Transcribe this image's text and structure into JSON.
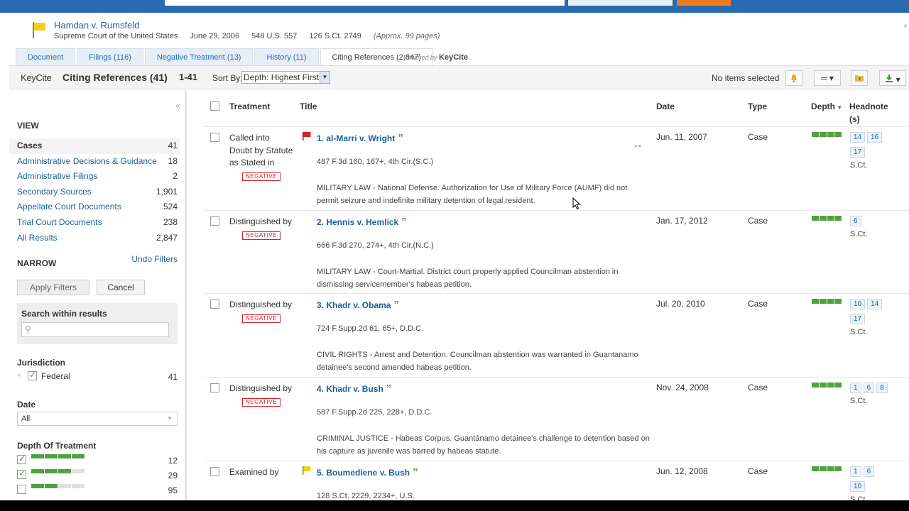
{
  "doc": {
    "title": "Hamdan v. Rumsfeld",
    "court": "Supreme Court of the United States",
    "date": "June 29, 2006",
    "cite1": "548 U.S. 557",
    "cite2": "126 S.Ct. 2749",
    "pages": "(Approx. 99 pages)"
  },
  "tabs": [
    {
      "label": "Document"
    },
    {
      "label": "Filings (116)"
    },
    {
      "label": "Negative Treatment (13)"
    },
    {
      "label": "History (11)"
    },
    {
      "label": "Citing References (2,847)"
    }
  ],
  "powered": {
    "prefix": "Powered by",
    "brand": "KeyCite"
  },
  "toolbar": {
    "logo": "KeyCite",
    "title": "Citing References (41)",
    "range": "1-41",
    "sort_label": "Sort By:",
    "sort_value": "Depth: Highest First",
    "selected": "No items selected"
  },
  "sidebar": {
    "view_heading": "VIEW",
    "view_items": [
      {
        "label": "Cases",
        "count": "41"
      },
      {
        "label": "Administrative Decisions & Guidance",
        "count": "18"
      },
      {
        "label": "Administrative Filings",
        "count": "2"
      },
      {
        "label": "Secondary Sources",
        "count": "1,901"
      },
      {
        "label": "Appellate Court Documents",
        "count": "524"
      },
      {
        "label": "Trial Court Documents",
        "count": "238"
      },
      {
        "label": "All Results",
        "count": "2,847"
      }
    ],
    "narrow_heading": "NARROW",
    "undo": "Undo Filters",
    "apply": "Apply Filters",
    "cancel": "Cancel",
    "search_title": "Search within results",
    "jurisdiction_heading": "Jurisdiction",
    "jurisdiction_item": "Federal",
    "jurisdiction_count": "41",
    "date_heading": "Date",
    "date_value": "All",
    "depth_heading": "Depth Of Treatment",
    "depth_counts": [
      "12",
      "29",
      "95"
    ]
  },
  "table": {
    "headers": {
      "treatment": "Treatment",
      "title": "Title",
      "date": "Date",
      "type": "Type",
      "depth": "Depth",
      "headnote": "Headnote (s)"
    },
    "negative_label": "NEGATIVE",
    "rows": [
      {
        "treatment": "Called into Doubt by Statute as Stated in",
        "title": "1. al-Marri v. Wright",
        "cite": "487 F.3d 160, 167+, 4th Cir.(S.C.)",
        "summary": "MILITARY LAW - National Defense. Authorization for Use of Military Force (AUMF) did not permit seizure and indefinite military detention of legal resident.",
        "date": "Jun. 11, 2007",
        "type": "Case",
        "headnotes": [
          "14",
          "16",
          "17"
        ],
        "reporter": "S.Ct."
      },
      {
        "treatment": "Distinguished by",
        "title": "2. Hennis v. Hemlick",
        "cite": "666 F.3d 270, 274+, 4th Cir.(N.C.)",
        "summary": "MILITARY LAW - Court-Martial. District court properly applied Councilman abstention in dismissing servicemember's habeas petition.",
        "date": "Jan. 17, 2012",
        "type": "Case",
        "headnotes": [
          "6"
        ],
        "reporter": "S.Ct."
      },
      {
        "treatment": "Distinguished by",
        "title": "3. Khadr v. Obama",
        "cite": "724 F.Supp.2d 61, 65+, D.D.C.",
        "summary": "CIVIL RIGHTS - Arrest and Detention. Councilman abstention was warranted in Guantanamo detainee's second amended habeas petition.",
        "date": "Jul. 20, 2010",
        "type": "Case",
        "headnotes": [
          "10",
          "14",
          "17"
        ],
        "reporter": "S.Ct."
      },
      {
        "treatment": "Distinguished by",
        "title": "4. Khadr v. Bush",
        "cite": "587 F.Supp.2d 225, 228+, D.D.C.",
        "summary": "CRIMINAL JUSTICE - Habeas Corpus. Guantánamo detainee's challenge to detention based on his capture as juvenile was barred by habeas statute.",
        "date": "Nov. 24, 2008",
        "type": "Case",
        "headnotes": [
          "1",
          "6",
          "8"
        ],
        "reporter": "S.Ct."
      },
      {
        "treatment": "Examined by",
        "title": "5. Boumediene v. Bush",
        "cite": "128 S.Ct. 2229, 2234+, U.S.",
        "summary": "",
        "date": "Jun. 12, 2008",
        "type": "Case",
        "headnotes": [
          "1",
          "6",
          "10"
        ],
        "reporter": "S.Ct."
      }
    ]
  },
  "colors": {
    "link": "#1a5f9e",
    "negative": "#d4262e",
    "depth_green": "#4fa23d",
    "topbar": "#2a6ab0"
  }
}
